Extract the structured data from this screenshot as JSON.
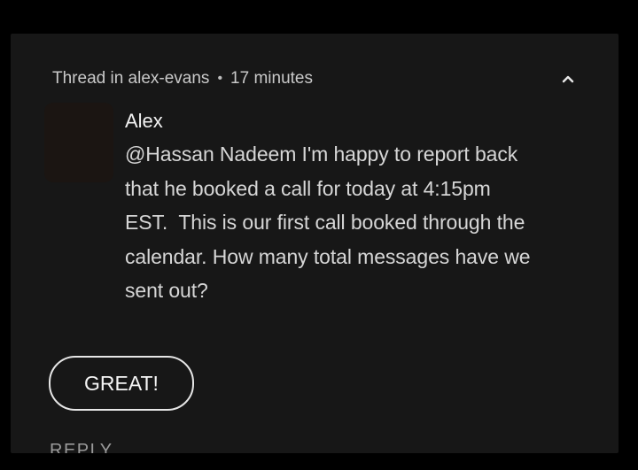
{
  "thread": {
    "location": "Thread in alex-evans",
    "separator": "•",
    "time": "17 minutes"
  },
  "icons": {
    "collapse": "chevron-up-icon"
  },
  "message": {
    "sender": "Alex",
    "lines": [
      "@Hassan Nadeem I'm happy to report back",
      "that he booked a call for today at 4:15pm",
      "EST.  This is our first call booked through the",
      "calendar. How many total messages have we",
      "sent out?"
    ]
  },
  "actions": {
    "quick_reply": "GREAT!",
    "reply": "REPLY"
  },
  "colors": {
    "background": "#000000",
    "card": "#171717",
    "text_primary": "#f2f2f2",
    "text_secondary": "#c9c9c9"
  }
}
